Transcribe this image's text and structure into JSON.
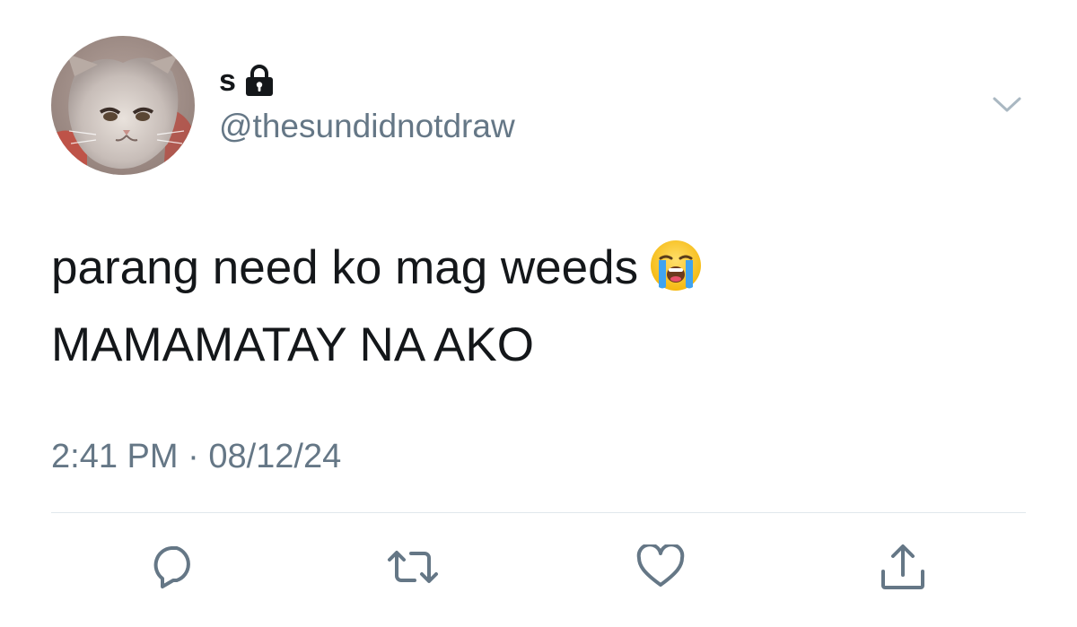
{
  "tweet": {
    "author": {
      "display_name": "s",
      "handle": "@thesundidnotdraw",
      "protected_icon": "lock-icon",
      "avatar": "cat-avatar"
    },
    "text_lines": [
      "parang need ko mag weeds",
      "MAMAMATAY NA AKO"
    ],
    "emoji": "loudly-crying-face-emoji",
    "time": "2:41 PM",
    "separator": " · ",
    "date": "08/12/24",
    "menu_icon": "chevron-down-icon"
  },
  "actions": [
    {
      "name": "reply",
      "icon": "reply-icon"
    },
    {
      "name": "retweet",
      "icon": "retweet-icon"
    },
    {
      "name": "like",
      "icon": "heart-icon"
    },
    {
      "name": "share",
      "icon": "share-icon"
    }
  ],
  "colors": {
    "text": "#14171a",
    "secondary": "#657786",
    "icon": "#657786",
    "divider": "#e1e8ed"
  }
}
